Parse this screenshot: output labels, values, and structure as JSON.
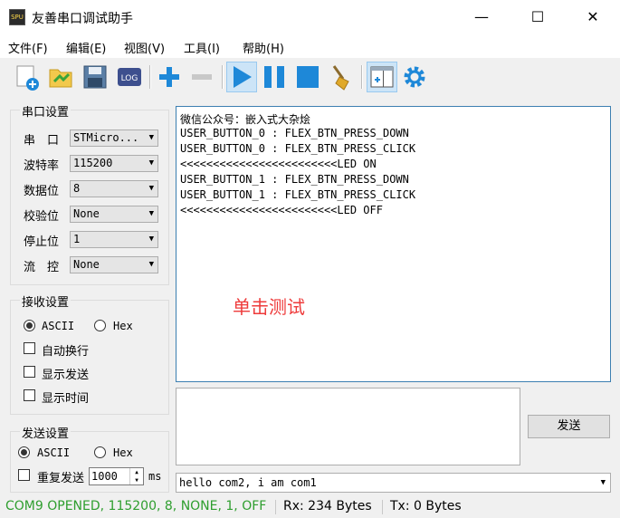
{
  "window": {
    "title": "友善串口调试助手",
    "app_icon_text": "SPU",
    "controls": {
      "minimize": "—",
      "maximize": "☐",
      "close": "✕"
    }
  },
  "menu": [
    {
      "label": "文件(F)"
    },
    {
      "label": "编辑(E)"
    },
    {
      "label": "视图(V)"
    },
    {
      "label": "工具(I)"
    },
    {
      "label": "帮助(H)"
    }
  ],
  "toolbar": {
    "icons": [
      "new-document-icon",
      "open-folder-icon",
      "save-icon",
      "log-icon",
      "add-icon",
      "remove-icon",
      "play-icon",
      "pause-icon",
      "stop-icon",
      "clear-broom-icon",
      "layout-window-icon",
      "settings-gear-icon"
    ],
    "log_label": "LOG",
    "accent": "#1e88d8"
  },
  "serial_settings": {
    "title": "串口设置",
    "rows": [
      {
        "label": "串　口",
        "value": "STMicro..."
      },
      {
        "label": "波特率",
        "value": "115200"
      },
      {
        "label": "数据位",
        "value": "8"
      },
      {
        "label": "校验位",
        "value": "None"
      },
      {
        "label": "停止位",
        "value": "1"
      },
      {
        "label": "流　控",
        "value": "None"
      }
    ]
  },
  "receive_settings": {
    "title": "接收设置",
    "radio_ascii": "ASCII",
    "radio_hex": "Hex",
    "selected": "ASCII",
    "checks": [
      {
        "label": "自动换行",
        "checked": false
      },
      {
        "label": "显示发送",
        "checked": false
      },
      {
        "label": "显示时间",
        "checked": false
      }
    ]
  },
  "send_settings": {
    "title": "发送设置",
    "radio_ascii": "ASCII",
    "radio_hex": "Hex",
    "selected": "ASCII",
    "repeat_label": "重复发送",
    "repeat_checked": false,
    "interval_value": "1000",
    "interval_unit": "ms"
  },
  "receive_area": {
    "lines": [
      "微信公众号：嵌入式大杂烩",
      "USER_BUTTON_0 : FLEX_BTN_PRESS_DOWN",
      "USER_BUTTON_0 : FLEX_BTN_PRESS_CLICK",
      "<<<<<<<<<<<<<<<<<<<<<<<<LED ON",
      "USER_BUTTON_1 : FLEX_BTN_PRESS_DOWN",
      "USER_BUTTON_1 : FLEX_BTN_PRESS_CLICK",
      "<<<<<<<<<<<<<<<<<<<<<<<<LED OFF"
    ],
    "annotation": "单击测试",
    "annotation_color": "#ee3b3b"
  },
  "send_area": {
    "text": "",
    "send_button": "发送",
    "history_value": "hello com2, i am com1"
  },
  "status_bar": {
    "port_status": "COM9 OPENED, 115200, 8, NONE, 1, OFF",
    "port_status_color": "#2e9e2e",
    "rx": "Rx: 234 Bytes",
    "tx": "Tx: 0 Bytes"
  }
}
